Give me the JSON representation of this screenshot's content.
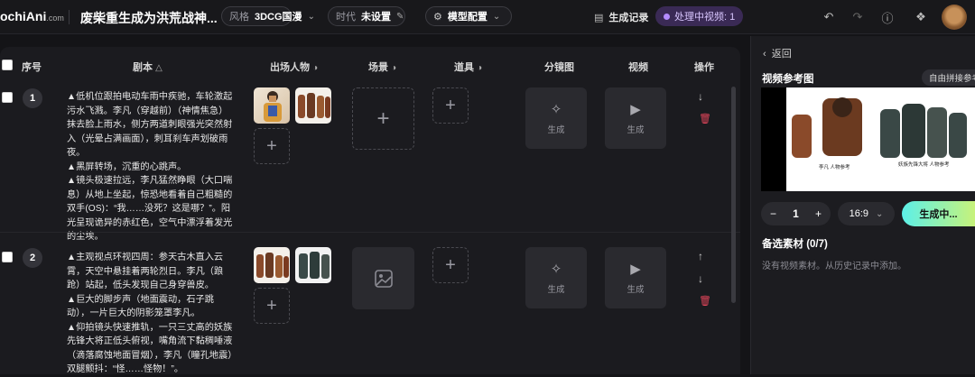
{
  "header": {
    "logo_main": "ochiAni",
    "logo_domain": ".com",
    "project_title": "废柴重生成为洪荒战神...",
    "style_label": "风格",
    "style_value": "3DCG国漫",
    "era_label": "时代",
    "era_value": "未设置",
    "model_config_label": "模型配置",
    "history_label": "生成记录",
    "processing_label": "处理中视频: 1"
  },
  "table": {
    "columns": {
      "index": "序号",
      "script": "剧本",
      "characters": "出场人物",
      "scene": "场景",
      "props": "道具",
      "storyboard": "分镜图",
      "video": "视频",
      "actions": "操作"
    },
    "rows": [
      {
        "index": "1",
        "script": "▲低机位跟拍电动车雨中疾驰，车轮激起污水飞溅。李凡（穿越前）（神情焦急）抹去脸上雨水，侧方两道刺眼强光突然射入（光晕占满画面），刺耳刹车声划破雨夜。\n▲黑屏转场，沉重的心跳声。\n▲镜头极速拉远，李凡猛然睁眼（大口喘息）从地上坐起，惊恐地看着自己粗糙的双手(OS)：“我……没死？这是哪？”。阳光呈现诡异的赤红色，空气中漂浮着发光的尘埃。",
        "storyboard_btn": "生成",
        "video_btn": "生成"
      },
      {
        "index": "2",
        "script": "▲主观视点环视四周：参天古木直入云霄，天空中悬挂着两轮烈日。李凡（踉跄）站起，低头发现自己身穿兽皮。\n▲巨大的脚步声（地面震动，石子跳动），一片巨大的阴影笼罩李凡。\n▲仰拍镜头快速推轨，一只三丈高的妖族先锋大将正低头俯视，嘴角流下黏稠唾液（滴落腐蚀地面冒烟），李凡（瞳孔地震）双腿颤抖：“怪……怪物！”。",
        "storyboard_btn": "生成",
        "video_btn": "生成"
      }
    ]
  },
  "panel": {
    "back_label": "返回",
    "ref_title": "视频参考图",
    "free_stitch_label": "自由拼接参考",
    "ref_caption_left": "李凡 人物参考",
    "ref_caption_right": "妖族先锋大将 人物参考",
    "count_value": "1",
    "ratio_value": "16:9",
    "generate_label": "生成中...",
    "candidates_title": "备选素材 (0/7)",
    "candidates_hint": "没有视频素材。从历史记录中添加。"
  },
  "colors": {
    "accent_purple": "#b48cff",
    "delete_red": "#e0455a",
    "gen_gradient_start": "#5cf0e8",
    "gen_gradient_end": "#c7f27a"
  }
}
